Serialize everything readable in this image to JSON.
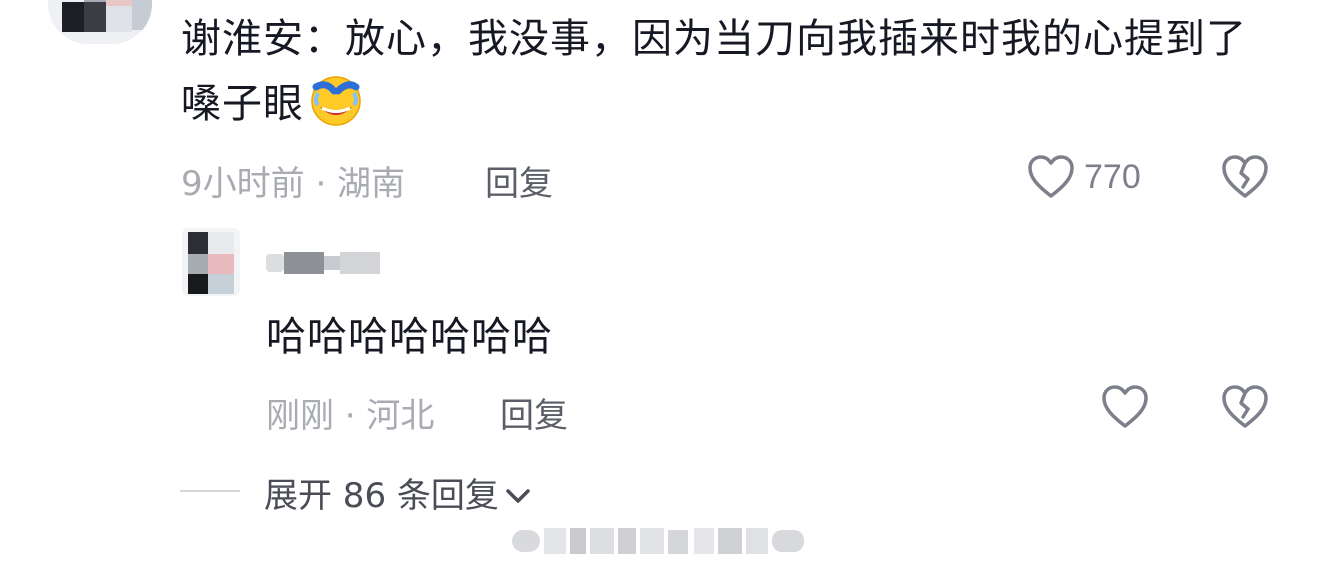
{
  "comment": {
    "text": "谢淮安：放心，我没事，因为当刀向我插来时我的心提到了嗓子眼",
    "emoji_icon": "laughing-crying-emoji-icon",
    "meta": "9小时前 · 湖南",
    "reply_label": "回复",
    "like_count": "770"
  },
  "reply": {
    "text": "哈哈哈哈哈哈哈",
    "meta": "刚刚 · 河北",
    "reply_label": "回复"
  },
  "expand": {
    "label": "展开 86 条回复"
  },
  "colors": {
    "text_primary": "#161823",
    "text_meta": "#a9abb2",
    "icon_gray": "#7d808a"
  }
}
